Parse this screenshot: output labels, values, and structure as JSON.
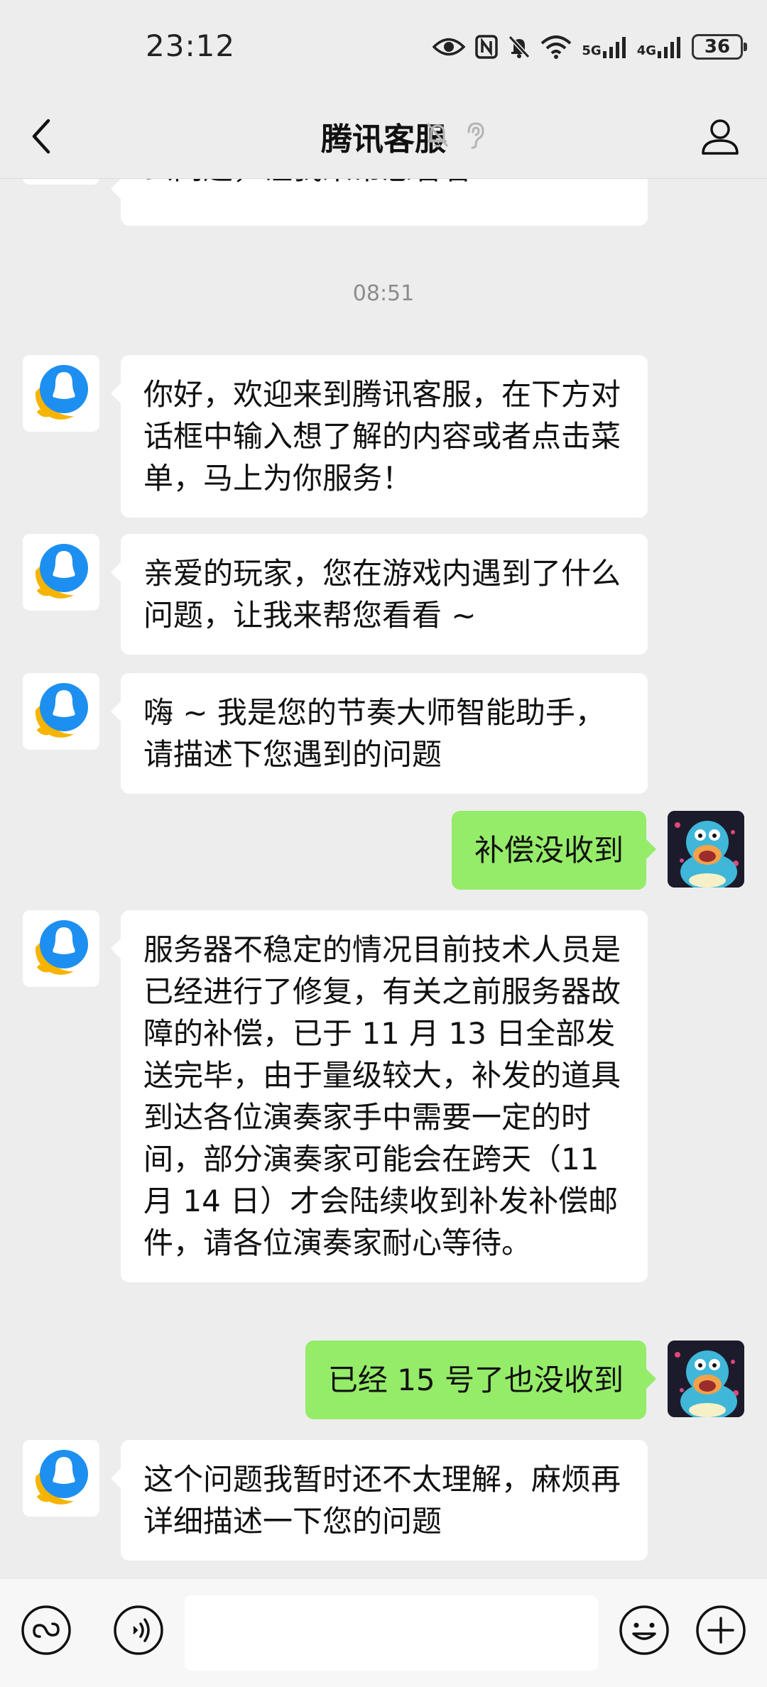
{
  "status_bar": {
    "time": "23:12",
    "signal_1": "5G",
    "signal_2": "4G",
    "battery": "36"
  },
  "header": {
    "title": "腾讯客服"
  },
  "chat": {
    "top_partial": "么问题，让我来帮您看看 ~",
    "timestamp": "08:51",
    "messages": [
      {
        "side": "left",
        "text": "你好，欢迎来到腾讯客服，在下方对话框中输入想了解的内容或者点击菜单，马上为你服务！"
      },
      {
        "side": "left",
        "text": "亲爱的玩家，您在游戏内遇到了什么问题，让我来帮您看看 ~"
      },
      {
        "side": "left",
        "text": "嗨 ~ 我是您的节奏大师智能助手，请描述下您遇到的问题"
      },
      {
        "side": "right",
        "text": "补偿没收到"
      },
      {
        "side": "left",
        "text": "服务器不稳定的情况目前技术人员是已经进行了修复，有关之前服务器故障的补偿，已于 11 月 13 日全部发送完毕，由于量级较大，补发的道具到达各位演奏家手中需要一定的时间，部分演奏家可能会在跨天（11 月 14 日）才会陆续收到补发补偿邮件，请各位演奏家耐心等待。"
      },
      {
        "side": "right",
        "text": "已经 15 号了也没收到"
      },
      {
        "side": "left",
        "text": "这个问题我暂时还不太理解，麻烦再详细描述一下您的问题"
      }
    ]
  },
  "input": {
    "placeholder": ""
  },
  "colors": {
    "background": "#ededed",
    "bubble_self": "#95ec69",
    "bubble_other": "#ffffff",
    "brand_blue": "#1d8ff0",
    "brand_yellow": "#f6b400"
  }
}
